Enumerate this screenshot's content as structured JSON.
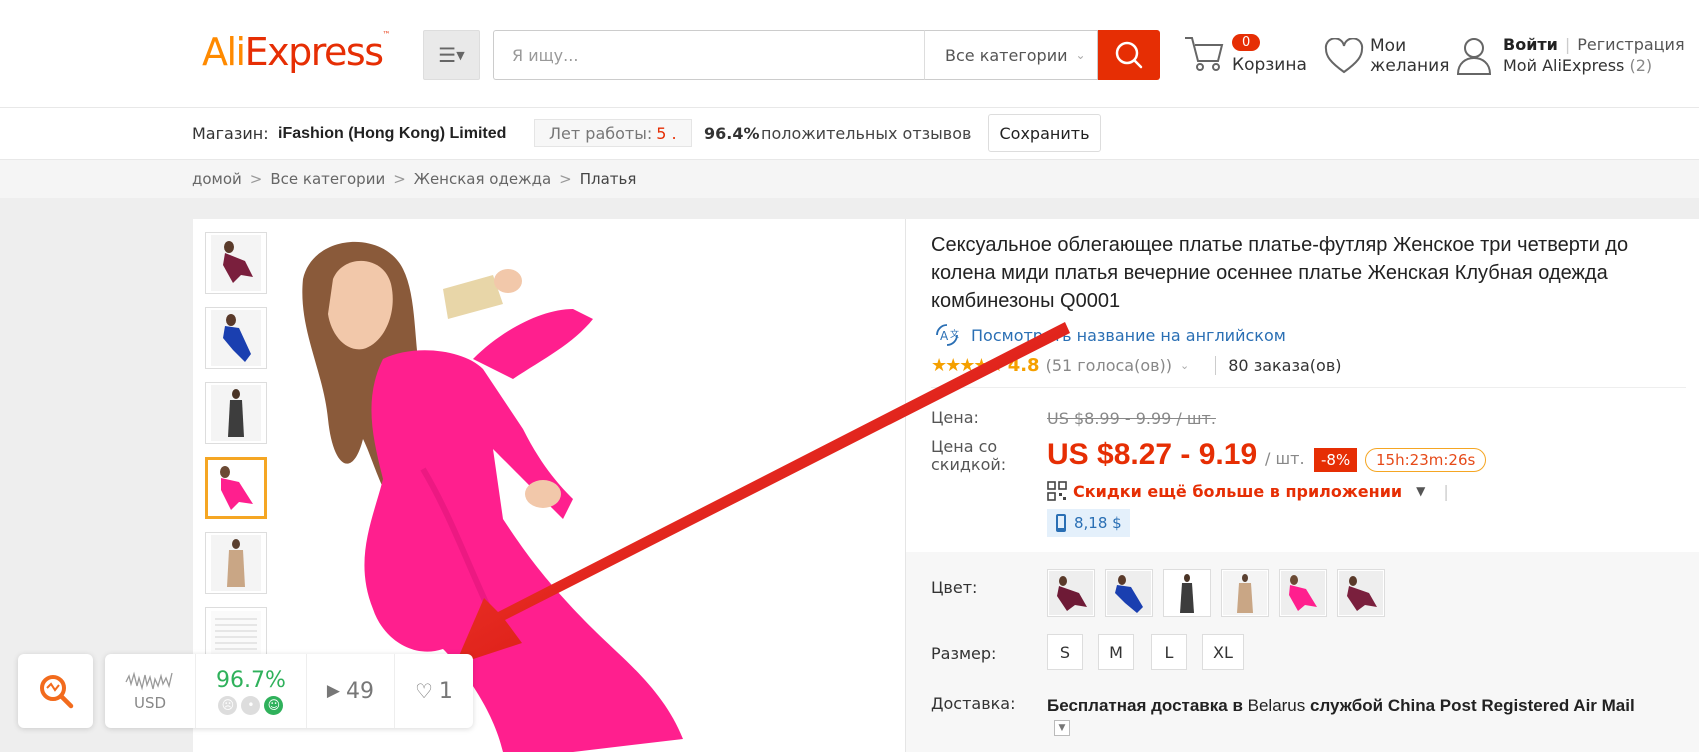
{
  "header": {
    "logo_ali": "AliExpress",
    "logo_tm": "™",
    "search_placeholder": "Я ищу...",
    "category_select": "Все категории",
    "cart_count": "0",
    "cart_label": "Корзина",
    "wishlist_label": "Мои желания",
    "login": "Войти",
    "register": "Регистрация",
    "my_aliexpress": "Мой AliExpress",
    "my_aliexpress_count": "(2)"
  },
  "store": {
    "label": "Магазин:",
    "name": "iFashion (Hong Kong) Limited",
    "years_label": "Лет работы:",
    "years_value": "5 .",
    "positive_pct": "96.4%",
    "positive_text": "положительных отзывов",
    "save_label": "Сохранить"
  },
  "breadcrumb": [
    "домой",
    "Все категории",
    "Женская одежда",
    "Платья"
  ],
  "product": {
    "title": "Сексуальное облегающее платье платье-футляр Женское три четверти до колена миди платья вечерние осеннее платье Женская Клубная одежда комбинезоны Q0001",
    "translate_link": "Посмотреть название на английском",
    "stars": "★★★★★",
    "rating": "4.8",
    "votes": "(51 голоса(ов))",
    "orders": "80 заказа(ов)",
    "price_label": "Цена:",
    "old_price": "US $8.99 - 9.99 / шт.",
    "discount_label": "Цена со скидкой:",
    "new_price": "US $8.27 - 9.19",
    "per_unit": "/ шт.",
    "discount_badge": "-8%",
    "timer": "15h:23m:26s",
    "app_discount": "Скидки ещё больше в приложении",
    "mobile_price": "8,18 $",
    "color_label": "Цвет:",
    "size_label": "Размер:",
    "sizes": [
      "S",
      "M",
      "L",
      "XL"
    ],
    "shipping_label": "Доставка:",
    "shipping_bold1": "Бесплатная доставка в",
    "shipping_country": "Belarus",
    "shipping_bold2": "службой",
    "shipping_service": "China Post Registered Air Mail"
  },
  "widget": {
    "currency": "USD",
    "rating_pct": "96.7%",
    "views": "49",
    "likes": "1"
  },
  "colors": {
    "accent": "#e62e04",
    "brand_orange": "#ff8a00",
    "dress_pink": "#ff1f8e",
    "star": "#f5a000",
    "link": "#2a6fb4",
    "green": "#2fb15b"
  }
}
